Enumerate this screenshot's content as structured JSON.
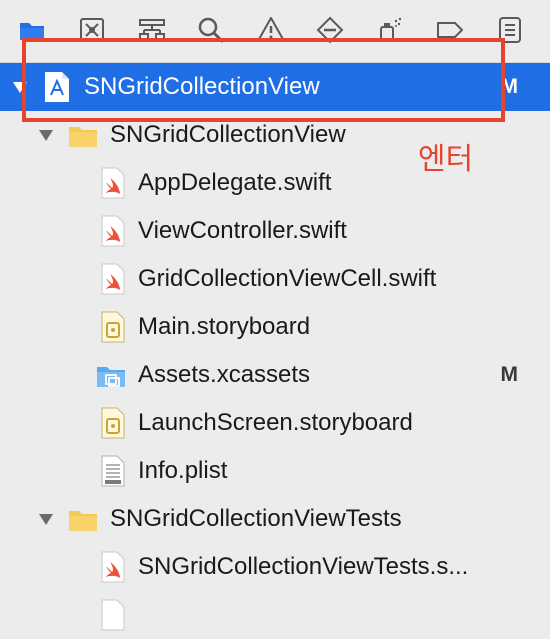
{
  "toolbar": {
    "icons": [
      "folder-icon",
      "source-control-icon",
      "hierarchy-icon",
      "search-icon",
      "warning-icon",
      "breakpoint-icon",
      "test-icon",
      "tag-icon",
      "report-icon"
    ]
  },
  "tree": [
    {
      "label": "SNGridCollectionView",
      "badge": "M",
      "kind": "project",
      "selected": true,
      "expanded": true
    },
    {
      "label": "SNGridCollectionView",
      "badge": "",
      "kind": "folder",
      "expanded": true
    },
    {
      "label": "AppDelegate.swift",
      "badge": "",
      "kind": "swift"
    },
    {
      "label": "ViewController.swift",
      "badge": "",
      "kind": "swift"
    },
    {
      "label": "GridCollectionViewCell.swift",
      "badge": "",
      "kind": "swift"
    },
    {
      "label": "Main.storyboard",
      "badge": "",
      "kind": "storyboard"
    },
    {
      "label": "Assets.xcassets",
      "badge": "M",
      "kind": "assets"
    },
    {
      "label": "LaunchScreen.storyboard",
      "badge": "",
      "kind": "storyboard"
    },
    {
      "label": "Info.plist",
      "badge": "",
      "kind": "plist"
    },
    {
      "label": "SNGridCollectionViewTests",
      "badge": "",
      "kind": "folder",
      "expanded": true
    },
    {
      "label": "SNGridCollectionViewTests.s...",
      "badge": "",
      "kind": "swift"
    }
  ],
  "annotation": {
    "text": "엔터",
    "color": "#e4452f"
  },
  "colors": {
    "selection": "#1f6ee6",
    "folder": "#f5c851",
    "swift": "#f05138",
    "toolbar_active": "#1f6ee6"
  }
}
